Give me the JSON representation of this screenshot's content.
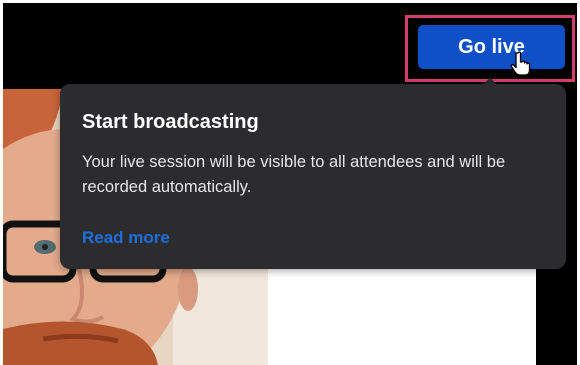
{
  "header": {
    "go_live_label": "Go live"
  },
  "popover": {
    "title": "Start broadcasting",
    "body": "Your live session will be visible to all attendees and will be recorded automatically.",
    "read_more_label": "Read more"
  },
  "colors": {
    "accent": "#0f4fc8",
    "highlight": "#d23d72",
    "popover_bg": "#2c2c2e",
    "link": "#1d6fe0"
  },
  "icons": {
    "cursor": "hand-pointer-icon"
  }
}
